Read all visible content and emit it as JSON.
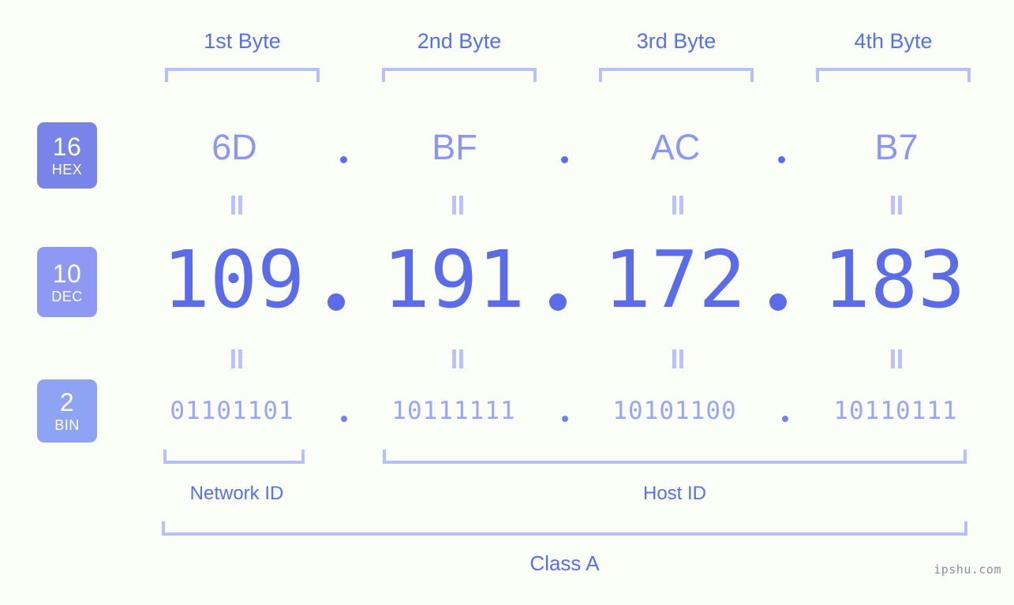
{
  "watermark": "ipshu.com",
  "byte_headers": [
    {
      "label": "1st Byte"
    },
    {
      "label": "2nd Byte"
    },
    {
      "label": "3rd Byte"
    },
    {
      "label": "4th Byte"
    }
  ],
  "rows": {
    "hex": {
      "badge_number": "16",
      "badge_name": "HEX",
      "values": [
        "6D",
        "BF",
        "AC",
        "B7"
      ],
      "separator": "."
    },
    "dec": {
      "badge_number": "10",
      "badge_name": "DEC",
      "values": [
        "109",
        "191",
        "172",
        "183"
      ],
      "separator": "."
    },
    "bin": {
      "badge_number": "2",
      "badge_name": "BIN",
      "values": [
        "01101101",
        "10111111",
        "10101100",
        "10110111"
      ],
      "separator": "."
    }
  },
  "ip_address": "109.191.172.183",
  "sections": {
    "network_id": "Network ID",
    "host_id": "Host ID",
    "class": "Class A"
  },
  "colors": {
    "background": "#fbfdf7",
    "accent_strong": "#5570f1",
    "accent_dec": "#5b6ce8",
    "accent_light": "#8b97f2",
    "bracket": "#b6c0fa",
    "badge_hex": "#7984e8",
    "badge_dec": "#8d99f2",
    "badge_bin": "#8fa3f5",
    "watermark": "#8a8f9c"
  }
}
